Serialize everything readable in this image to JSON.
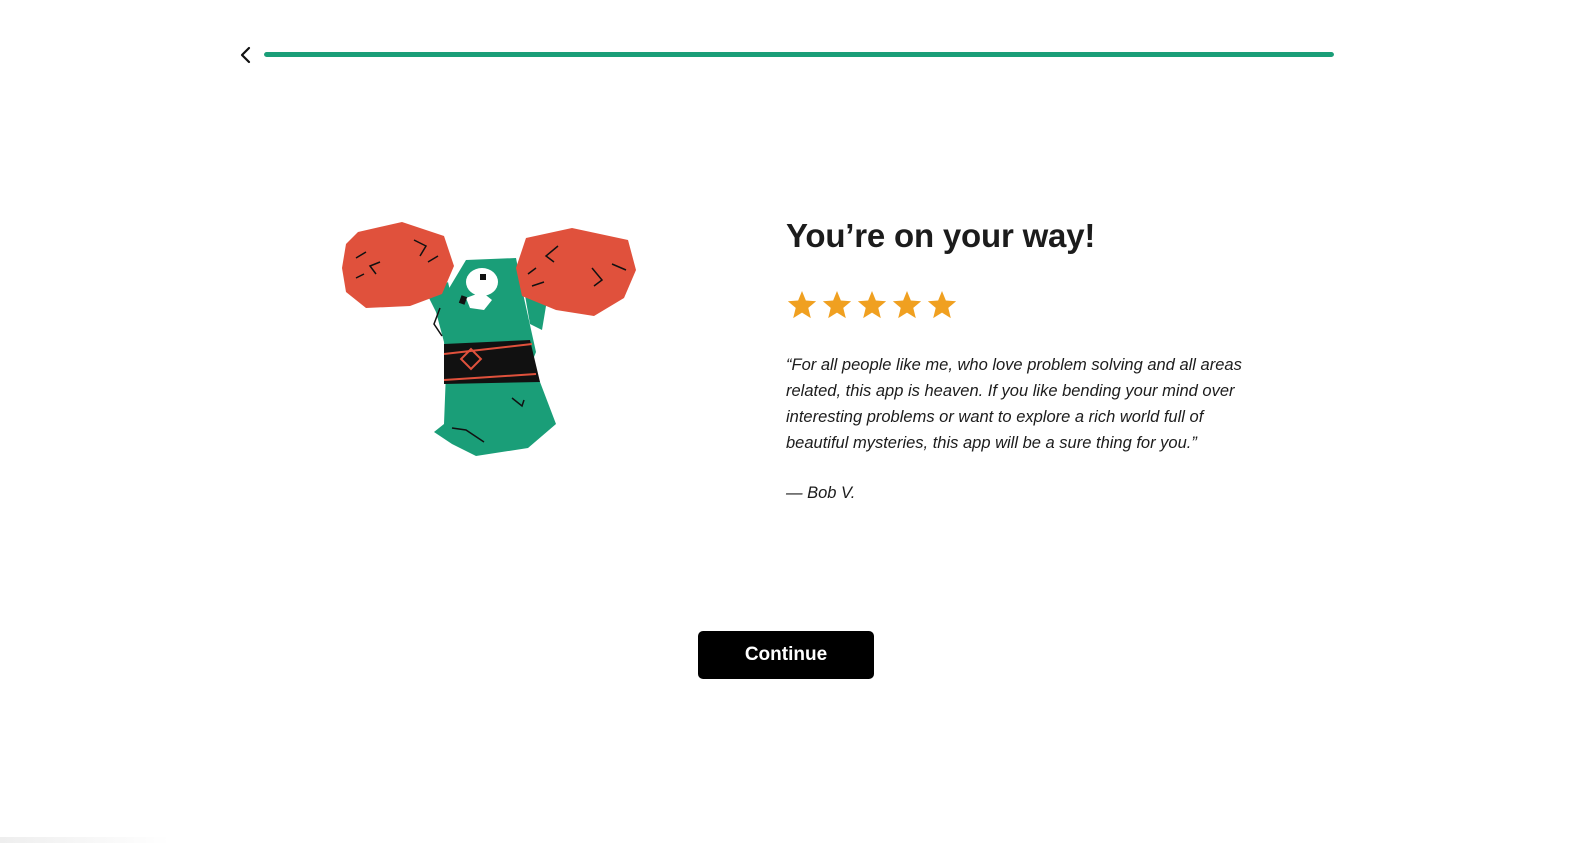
{
  "progress": {
    "value": 1.0,
    "color": "#1a9e78"
  },
  "icons": {
    "back": "chevron-left-icon",
    "star": "star-icon",
    "mascot": "mascot-cheering-illustration"
  },
  "main": {
    "title": "You’re on your way!",
    "rating": 5,
    "star_color": "#f0a020",
    "quote": "“For all people like me, who love problem solving and all areas related, this app is heaven. If you like bending your mind over interesting problems or want to explore a rich world full of beautiful mysteries, this app will be a sure thing for you.”",
    "author": "— Bob V."
  },
  "actions": {
    "continue_label": "Continue"
  },
  "colors": {
    "mascot_green": "#1a9e78",
    "pompom_red": "#e0513c",
    "button_bg": "#000000"
  }
}
